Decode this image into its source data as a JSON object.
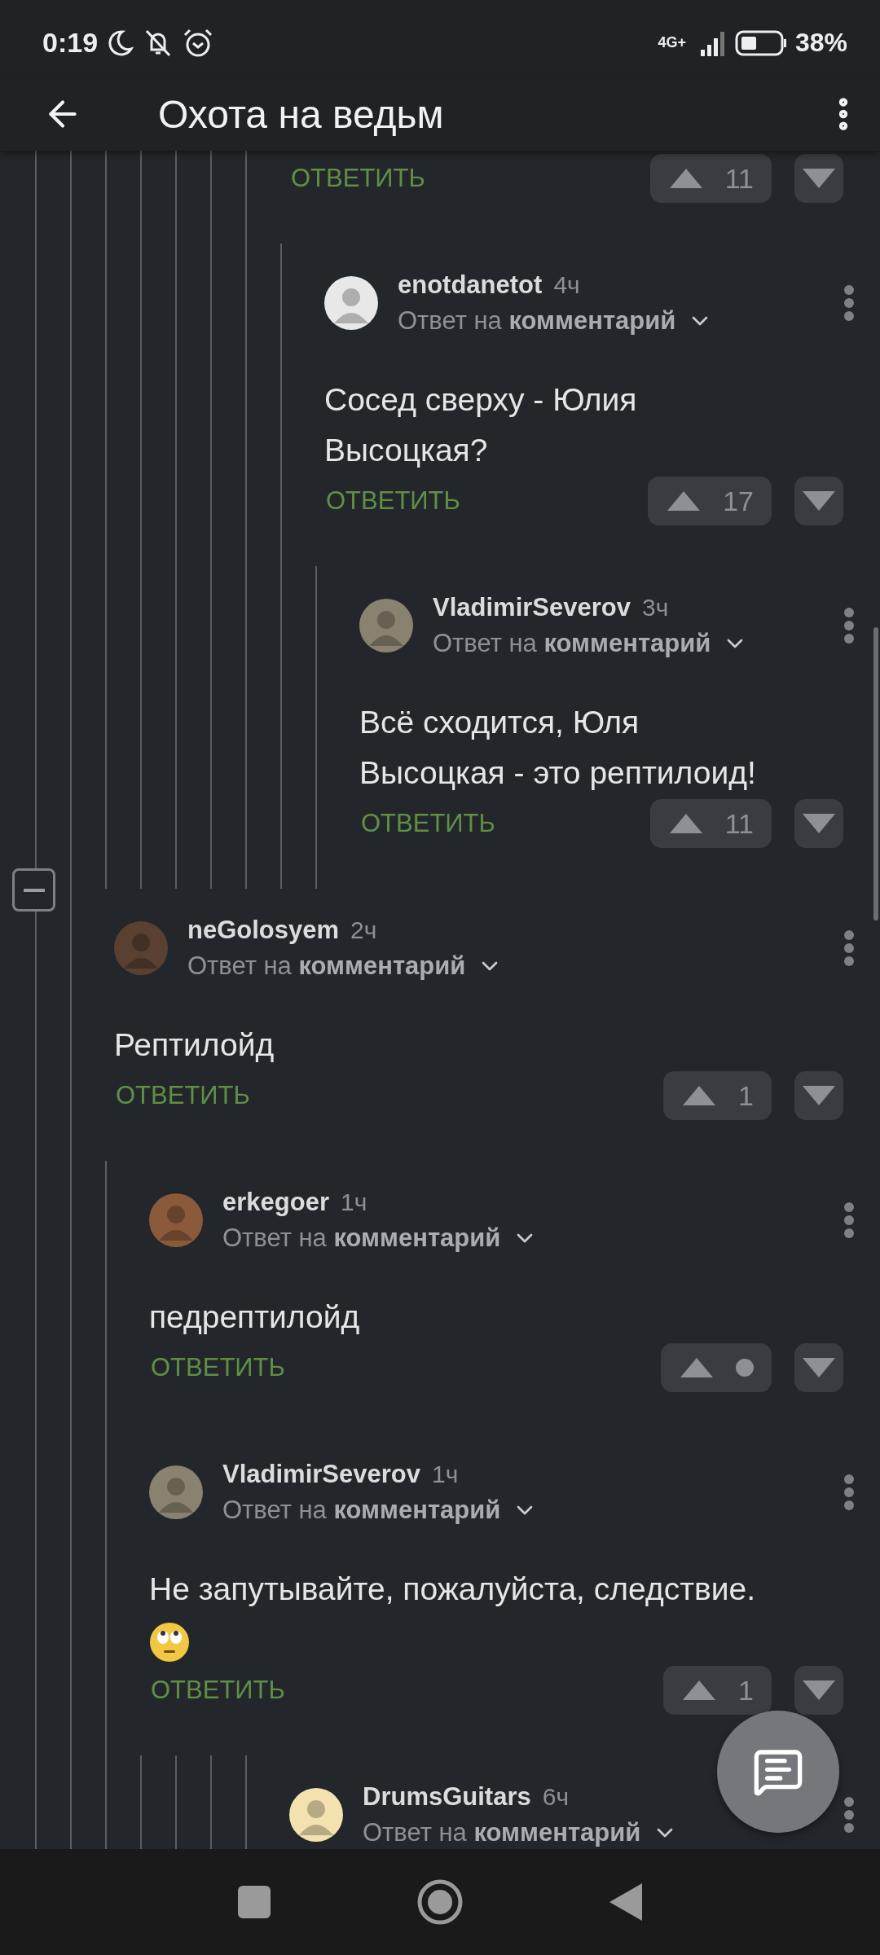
{
  "status_bar": {
    "time": "0:19",
    "network": "4G+",
    "battery": "38%"
  },
  "app_bar": {
    "title": "Охота на ведьм"
  },
  "threads": [
    {
      "kind": "footer_only",
      "reply": "ОТВЕТИТЬ",
      "score": "11",
      "children": [
        {
          "kind": "full",
          "author": "enotdanetot",
          "time": "4ч",
          "reply_to": "Ответ на **комментарий**",
          "text": [
            "Сосед сверху - Юлия",
            "Высоцкая?"
          ],
          "reply": "ОТВЕТИТЬ",
          "score": "17",
          "color": "#e8e8e8",
          "children": [
            {
              "kind": "full",
              "author": "VladimirSeverov",
              "time": "3ч",
              "reply_to": "Ответ на **комментарий**",
              "text": [
                "Всё сходится, Юля",
                "Высоцкая - это рептилоид!"
              ],
              "reply": "ОТВЕТИТЬ",
              "score": "11",
              "color": "#8a8270"
            }
          ]
        }
      ]
    },
    {
      "kind": "full",
      "author": "neGolosyem",
      "time": "2ч",
      "reply_to": "Ответ на **комментарий**",
      "text": [
        "Рептилойд"
      ],
      "reply": "ОТВЕТИТЬ",
      "score": "1",
      "color": "#5a4030",
      "collapse": true,
      "children": [
        {
          "kind": "full",
          "author": "erkegoer",
          "time": "1ч",
          "reply_to": "Ответ на **комментарий**",
          "text": [
            "педрептилойд"
          ],
          "reply": "ОТВЕТИТЬ",
          "score_hidden": true,
          "color": "#8a5a3a"
        },
        {
          "kind": "full",
          "author": "VladimirSeverov",
          "time": "1ч",
          "reply_to": "Ответ на **комментарий**",
          "text": [
            "Не запутывайте, пожалуйста, следствие."
          ],
          "emoji": true,
          "reply": "ОТВЕТИТЬ",
          "score": "1",
          "color": "#8a8270"
        }
      ]
    },
    {
      "kind": "header_only",
      "author": "DrumsGuitars",
      "time": "6ч",
      "reply_to": "Ответ на **комментарий**",
      "color": "#f3e2b0"
    }
  ]
}
